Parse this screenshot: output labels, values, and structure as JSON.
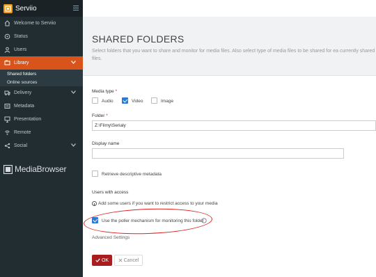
{
  "brand": {
    "name": "Serviio"
  },
  "nav": [
    {
      "label": "Welcome to Serviio",
      "icon": "home-icon"
    },
    {
      "label": "Status",
      "icon": "status-icon"
    },
    {
      "label": "Users",
      "icon": "user-icon"
    },
    {
      "label": "Library",
      "icon": "library-icon",
      "active": true
    },
    {
      "label": "Delivery",
      "icon": "delivery-icon"
    },
    {
      "label": "Metadata",
      "icon": "metadata-icon"
    },
    {
      "label": "Presentation",
      "icon": "presentation-icon"
    },
    {
      "label": "Remote",
      "icon": "remote-icon"
    },
    {
      "label": "Social",
      "icon": "share-icon"
    }
  ],
  "library_sub": [
    "Shared folders",
    "Online sources"
  ],
  "mediabrowser": {
    "label": "MediaBrowser"
  },
  "page": {
    "title": "SHARED FOLDERS",
    "description": "Select folders that you want to share and monitor for media files. Also select type of media files to be shared for ea currently shared files."
  },
  "form": {
    "media_type_label": "Media type",
    "required_mark": "*",
    "media_types": [
      {
        "label": "Audio",
        "checked": false
      },
      {
        "label": "Video",
        "checked": true
      },
      {
        "label": "Image",
        "checked": false
      }
    ],
    "folder_label": "Folder",
    "folder_value": "Z:\\Filmy\\Serialy",
    "display_name_label": "Display name",
    "display_name_value": "",
    "retrieve_metadata_label": "Retrieve descriptive metadata",
    "retrieve_metadata_checked": false,
    "users_access_label": "Users with access",
    "users_access_info": "Add some users if you want to restrict access to your media",
    "poller_label": "Use the poller mechanism for monitoring this folder",
    "poller_checked": true,
    "advanced_label": "Advanced Settings",
    "ok_label": "OK",
    "cancel_label": "Cancel"
  },
  "colors": {
    "sidebar_bg": "#222d32",
    "active_nav": "#d9541b",
    "ok_button": "#a81e1e",
    "checkbox_on": "#2b7bd6",
    "highlight_ellipse": "#dd2222"
  }
}
